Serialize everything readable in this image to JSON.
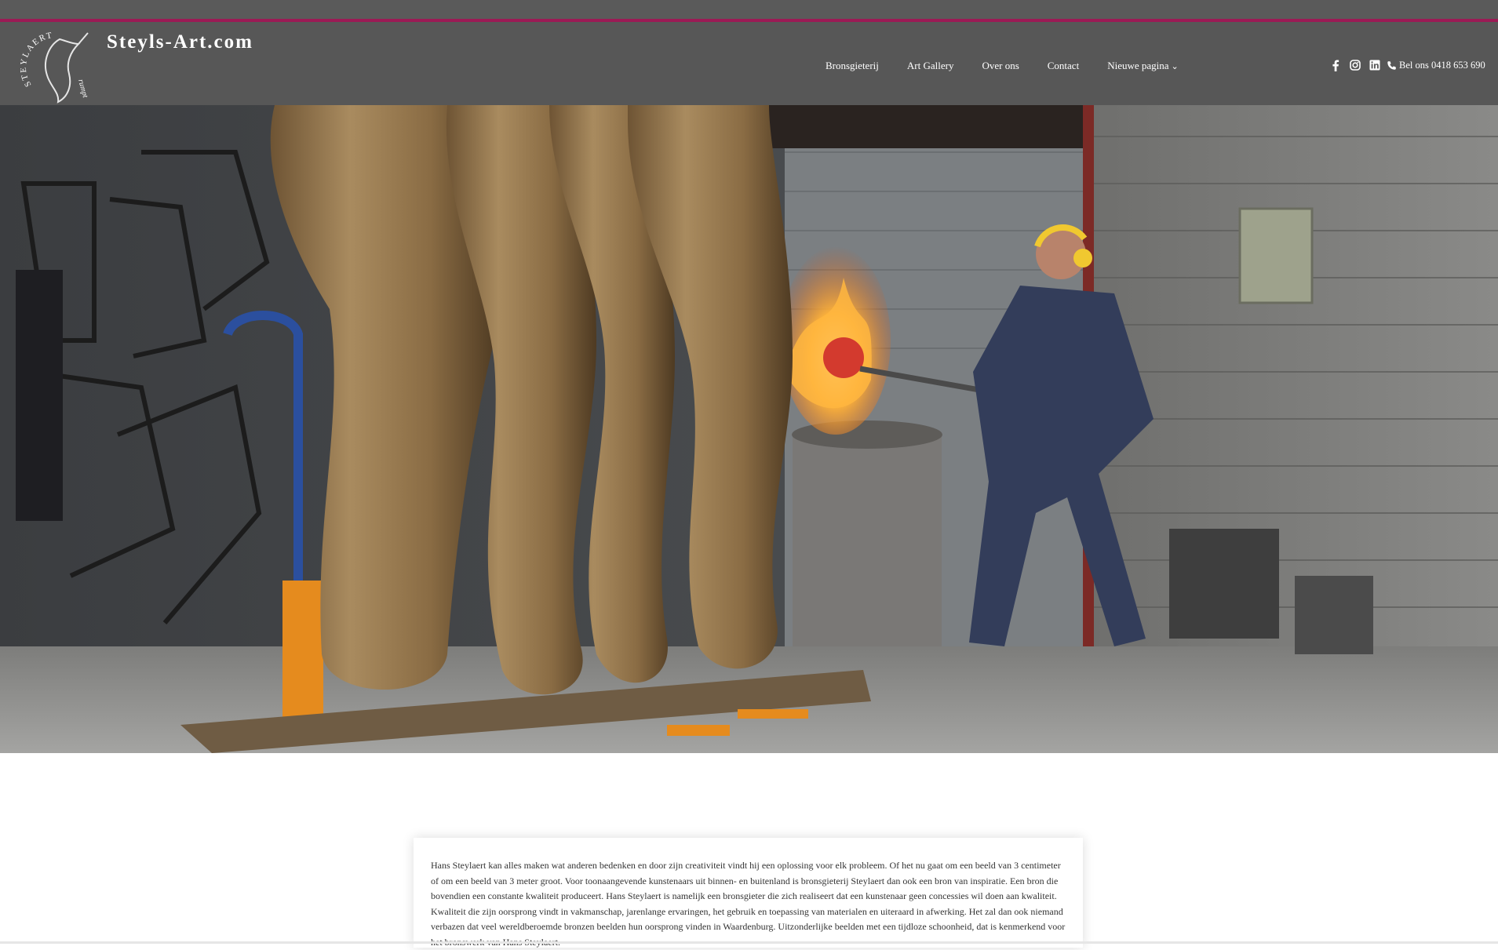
{
  "brand": {
    "name": "Steyls-Art.com",
    "logo_text": "STEYLAERT",
    "logo_signature": "rumpt"
  },
  "nav": {
    "items": [
      {
        "label": "Bronsgieterij"
      },
      {
        "label": "Art Gallery"
      },
      {
        "label": "Over ons"
      },
      {
        "label": "Contact"
      },
      {
        "label": "Nieuwe pagina",
        "has_dropdown": true
      }
    ]
  },
  "social": {
    "icons": [
      "facebook-icon",
      "instagram-icon",
      "linkedin-icon",
      "phone-icon"
    ],
    "phone_label": "Bel ons 0418 653 690"
  },
  "colors": {
    "header_bg": "#575757",
    "accent": "#9c1a55",
    "text_on_header": "#ffffff"
  },
  "content": {
    "intro": "Hans Steylaert kan alles maken wat anderen bedenken en door zijn creativiteit vindt hij een oplossing voor elk probleem. Of het nu gaat om een beeld van 3 centimeter of om een beeld van 3 meter groot. Voor toonaangevende kunstenaars uit binnen- en buitenland is bronsgieterij Steylaert dan ook een bron van inspiratie. Een bron die bovendien een constante kwaliteit produceert. Hans Steylaert is namelijk een bronsgieter die zich realiseert dat een kunstenaar geen concessies wil doen aan kwaliteit. Kwaliteit die zijn oorsprong vindt in vakmanschap, jarenlange ervaringen, het gebruik en toepassing van materialen en uiteraard in afwerking. Het zal dan ook niemand verbazen dat veel wereldberoemde bronzen beelden hun oorsprong vinden in Waardenburg. Uitzonderlijke beelden met een tijdloze schoonheid, dat is kenmerkend voor het bronswerk van Hans Steylaert."
  }
}
